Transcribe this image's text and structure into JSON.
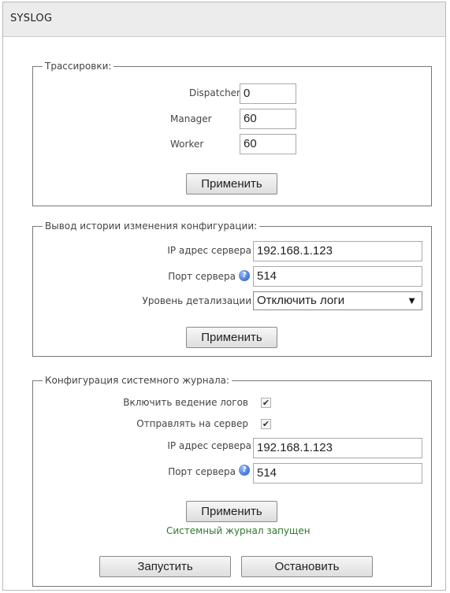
{
  "panel": {
    "title": "SYSLOG"
  },
  "tracing": {
    "legend": "Трассировки:",
    "fields": [
      {
        "label": "Dispatcher",
        "value": "0"
      },
      {
        "label": "Manager",
        "value": "60"
      },
      {
        "label": "Worker",
        "value": "60"
      }
    ],
    "apply_label": "Применить"
  },
  "config_history": {
    "legend": "Вывод истории изменения конфигурации:",
    "ip_label": "IP адрес сервера",
    "ip_value": "192.168.1.123",
    "port_label": "Порт сервера",
    "port_value": "514",
    "detail_label": "Уровень детализации",
    "detail_value": "Отключить логи",
    "apply_label": "Применить"
  },
  "syslog_config": {
    "legend": "Конфигурация системного журнала:",
    "enable_logging_label": "Включить ведение логов",
    "enable_logging_checked": true,
    "send_to_server_label": "Отправлять на сервер",
    "send_to_server_checked": true,
    "ip_label": "IP адрес сервера",
    "ip_value": "192.168.1.123",
    "port_label": "Порт сервера",
    "port_value": "514",
    "apply_label": "Применить",
    "status_text": "Системный журнал запущен",
    "start_label": "Запустить",
    "stop_label": "Остановить"
  },
  "icons": {
    "help": "question-icon",
    "check": "check-icon"
  },
  "colors": {
    "status_green": "#2c7a2c",
    "help_blue": "#2357b8"
  }
}
